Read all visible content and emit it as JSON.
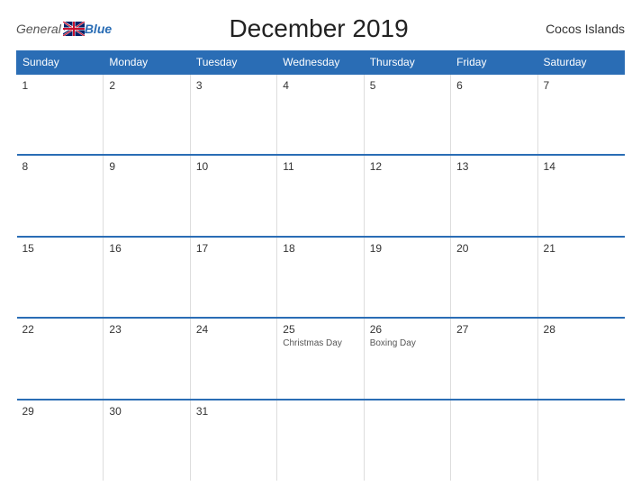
{
  "header": {
    "logo_general": "General",
    "logo_blue": "Blue",
    "title": "December 2019",
    "region": "Cocos Islands"
  },
  "calendar": {
    "days_of_week": [
      "Sunday",
      "Monday",
      "Tuesday",
      "Wednesday",
      "Thursday",
      "Friday",
      "Saturday"
    ],
    "weeks": [
      [
        {
          "day": "1",
          "events": []
        },
        {
          "day": "2",
          "events": []
        },
        {
          "day": "3",
          "events": []
        },
        {
          "day": "4",
          "events": []
        },
        {
          "day": "5",
          "events": []
        },
        {
          "day": "6",
          "events": []
        },
        {
          "day": "7",
          "events": []
        }
      ],
      [
        {
          "day": "8",
          "events": []
        },
        {
          "day": "9",
          "events": []
        },
        {
          "day": "10",
          "events": []
        },
        {
          "day": "11",
          "events": []
        },
        {
          "day": "12",
          "events": []
        },
        {
          "day": "13",
          "events": []
        },
        {
          "day": "14",
          "events": []
        }
      ],
      [
        {
          "day": "15",
          "events": []
        },
        {
          "day": "16",
          "events": []
        },
        {
          "day": "17",
          "events": []
        },
        {
          "day": "18",
          "events": []
        },
        {
          "day": "19",
          "events": []
        },
        {
          "day": "20",
          "events": []
        },
        {
          "day": "21",
          "events": []
        }
      ],
      [
        {
          "day": "22",
          "events": []
        },
        {
          "day": "23",
          "events": []
        },
        {
          "day": "24",
          "events": []
        },
        {
          "day": "25",
          "events": [
            "Christmas Day"
          ]
        },
        {
          "day": "26",
          "events": [
            "Boxing Day"
          ]
        },
        {
          "day": "27",
          "events": []
        },
        {
          "day": "28",
          "events": []
        }
      ],
      [
        {
          "day": "29",
          "events": []
        },
        {
          "day": "30",
          "events": []
        },
        {
          "day": "31",
          "events": []
        },
        {
          "day": "",
          "events": []
        },
        {
          "day": "",
          "events": []
        },
        {
          "day": "",
          "events": []
        },
        {
          "day": "",
          "events": []
        }
      ]
    ]
  }
}
